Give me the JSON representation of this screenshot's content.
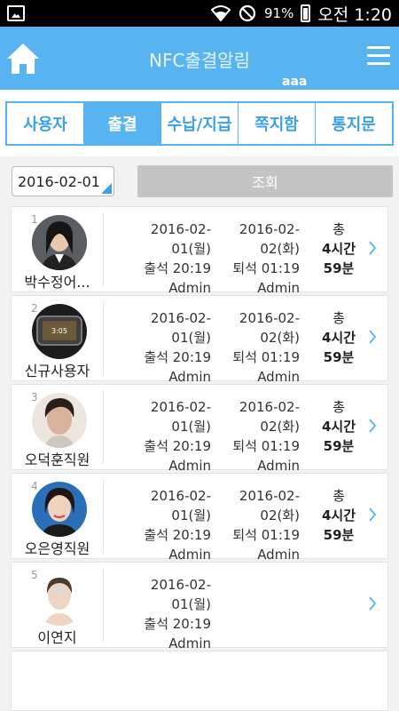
{
  "status_bar": {
    "battery": "91%",
    "time": "오전 1:20"
  },
  "header": {
    "title": "NFC출결알림",
    "user": "aaa"
  },
  "tabs": [
    {
      "label": "사용자",
      "active": false
    },
    {
      "label": "출결",
      "active": true
    },
    {
      "label": "수납/지급",
      "active": false
    },
    {
      "label": "쪽지함",
      "active": false
    },
    {
      "label": "통지문",
      "active": false
    }
  ],
  "search": {
    "date": "2016-02-01",
    "button_label": "조회"
  },
  "records": [
    {
      "index": "1",
      "name": "박수정어...",
      "in_date": "2016-02-01(월)",
      "in_time": "출석 20:19",
      "in_by": "Admin",
      "out_date": "2016-02-02(화)",
      "out_time": "퇴석 01:19",
      "out_by": "Admin",
      "total_label": "총",
      "total_hours": "4시간",
      "total_minutes": "59분"
    },
    {
      "index": "2",
      "name": "신규사용자",
      "in_date": "2016-02-01(월)",
      "in_time": "출석 20:19",
      "in_by": "Admin",
      "out_date": "2016-02-02(화)",
      "out_time": "퇴석 01:19",
      "out_by": "Admin",
      "total_label": "총",
      "total_hours": "4시간",
      "total_minutes": "59분"
    },
    {
      "index": "3",
      "name": "오덕훈직원",
      "in_date": "2016-02-01(월)",
      "in_time": "출석 20:19",
      "in_by": "Admin",
      "out_date": "2016-02-02(화)",
      "out_time": "퇴석 01:19",
      "out_by": "Admin",
      "total_label": "총",
      "total_hours": "4시간",
      "total_minutes": "59분"
    },
    {
      "index": "4",
      "name": "오은영직원",
      "in_date": "2016-02-01(월)",
      "in_time": "출석 20:19",
      "in_by": "Admin",
      "out_date": "2016-02-02(화)",
      "out_time": "퇴석 01:19",
      "out_by": "Admin",
      "total_label": "총",
      "total_hours": "4시간",
      "total_minutes": "59분"
    },
    {
      "index": "5",
      "name": "이연지",
      "in_date": "2016-02-01(월)",
      "in_time": "출석 20:19",
      "in_by": "Admin",
      "out_date": "",
      "out_time": "",
      "out_by": "",
      "total_label": "",
      "total_hours": "",
      "total_minutes": ""
    }
  ],
  "colors": {
    "accent": "#58b4f1",
    "tab_text": "#3aa0e8",
    "search_button": "#c4c4c4"
  }
}
